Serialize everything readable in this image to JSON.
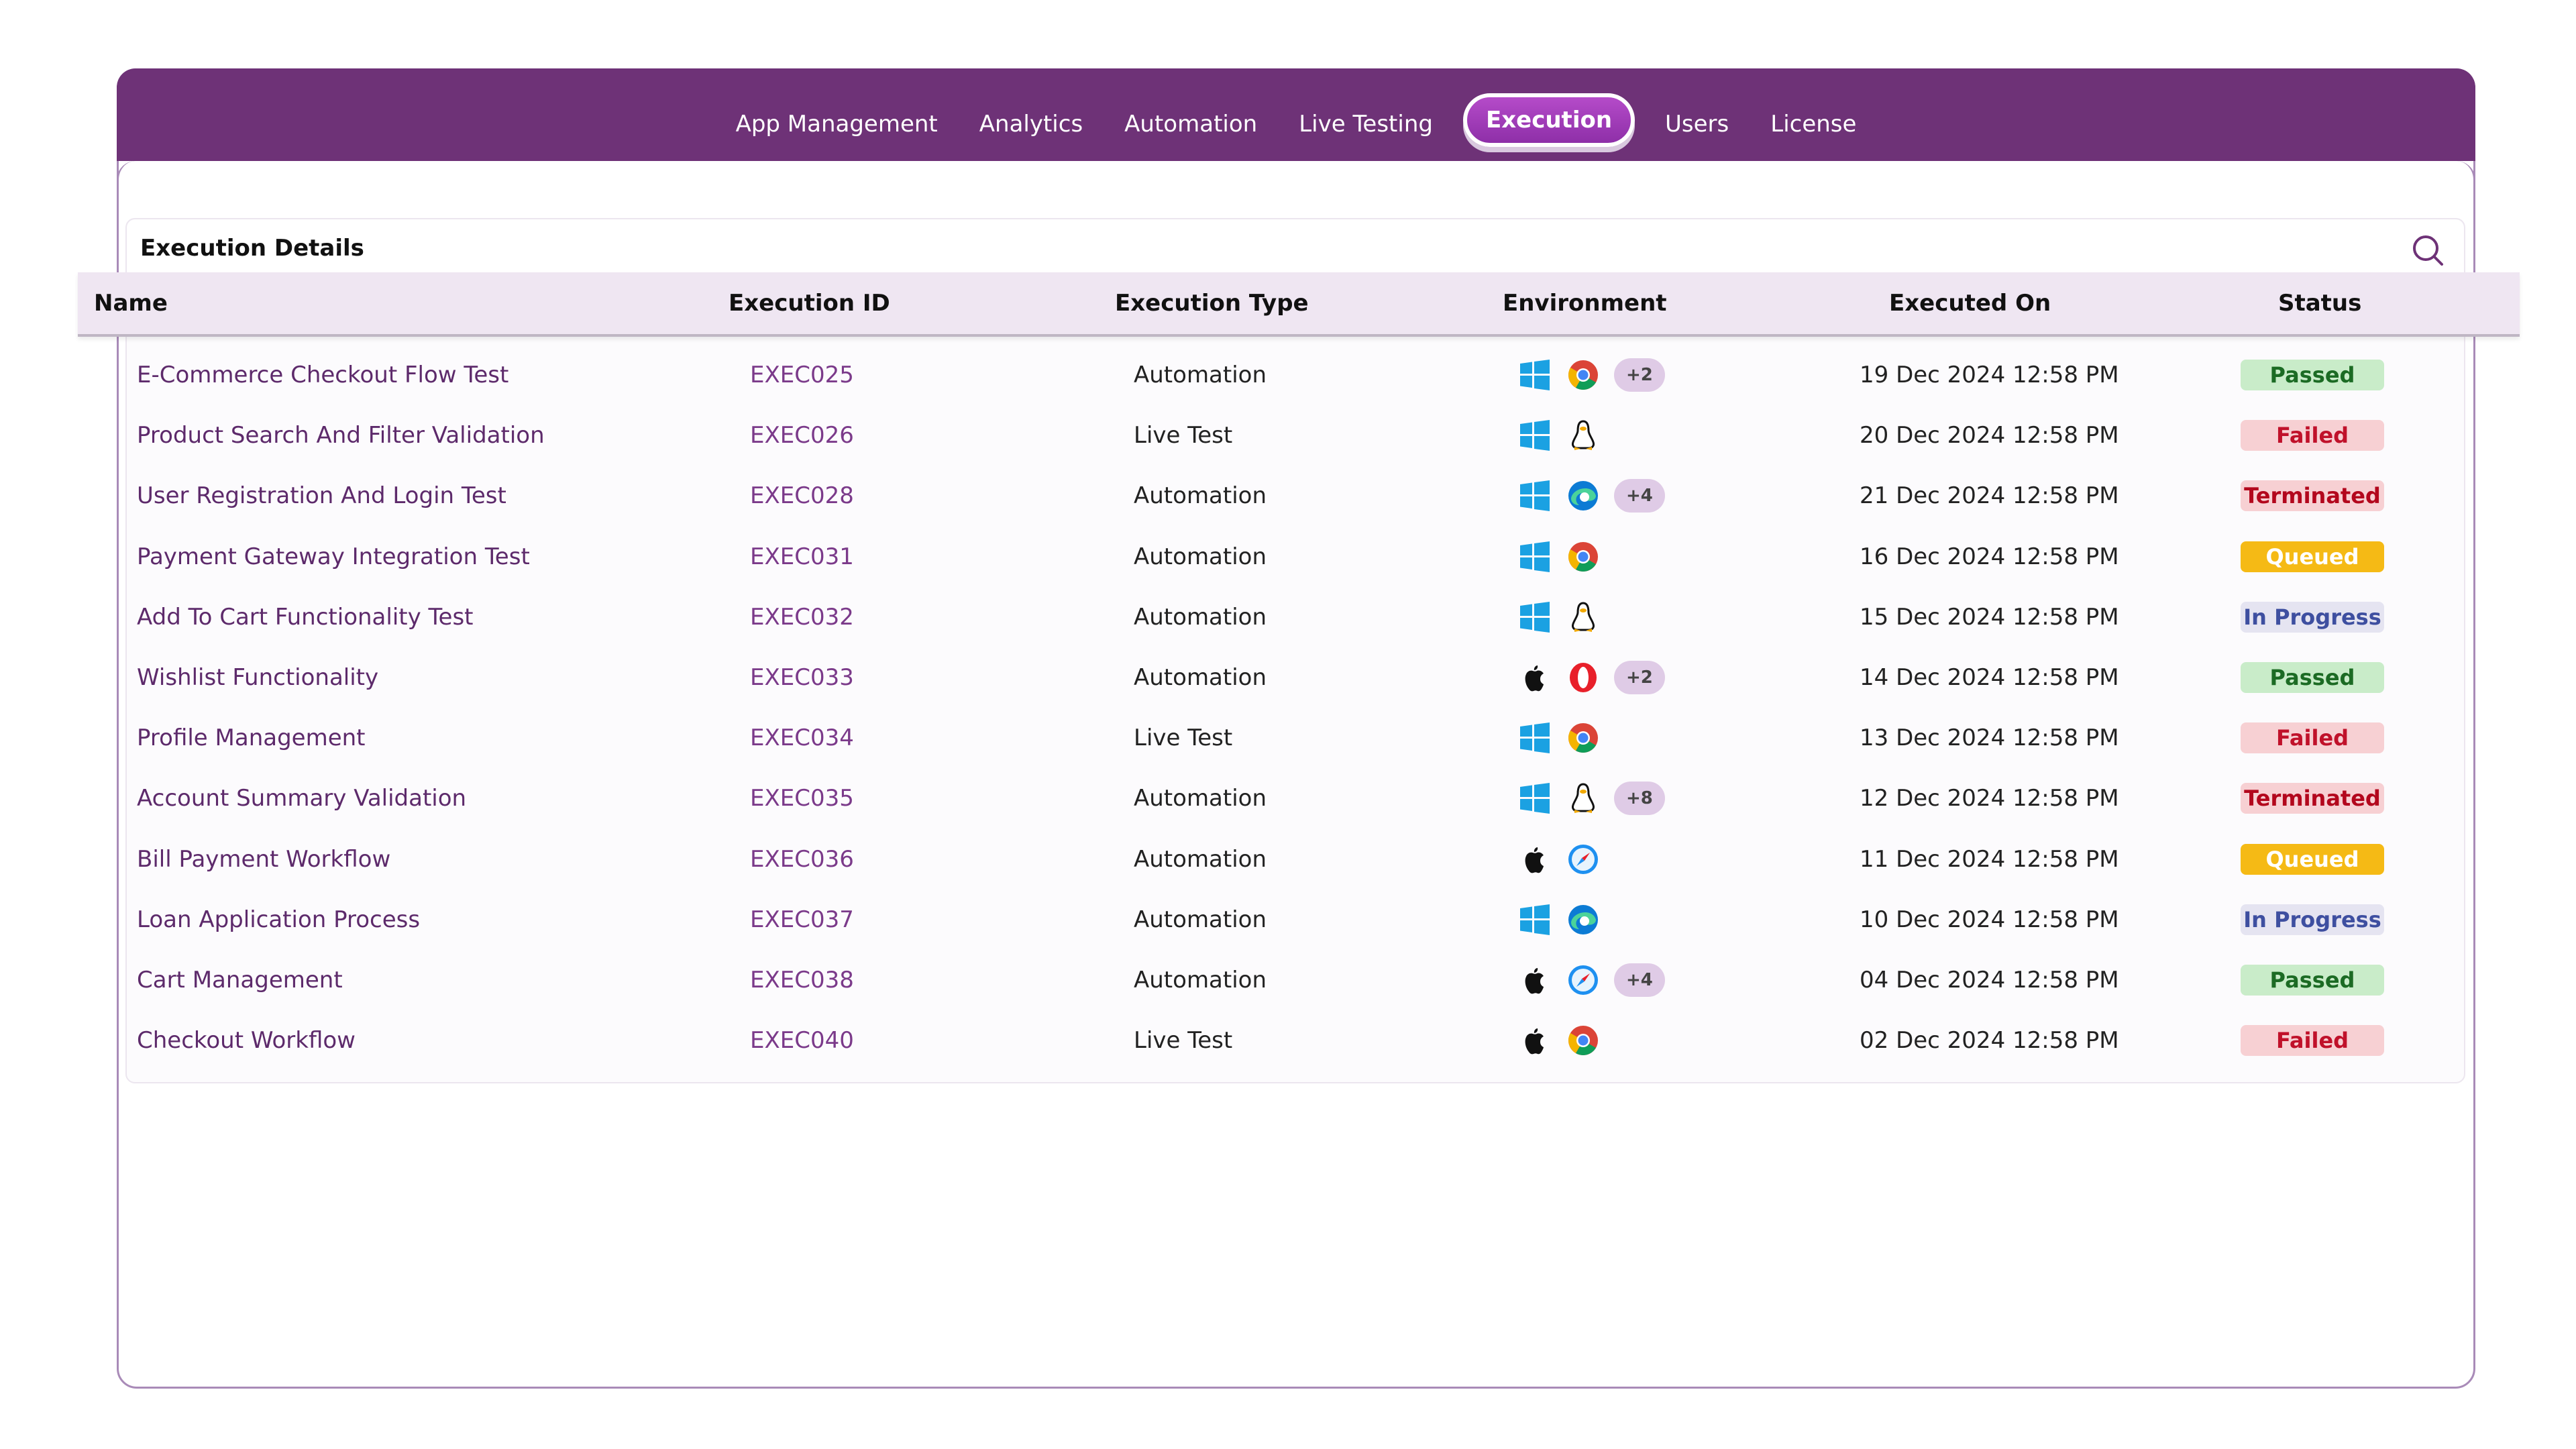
{
  "nav": {
    "items": [
      {
        "label": "App Management",
        "icon": ""
      },
      {
        "label": "Analytics"
      },
      {
        "label": "Automation"
      },
      {
        "label": "Live Testing"
      },
      {
        "label": "Execution",
        "active": true
      },
      {
        "label": "Users"
      },
      {
        "label": "License"
      }
    ]
  },
  "panel": {
    "title": "Execution Details",
    "search_icon": "search-icon"
  },
  "table": {
    "columns": [
      "Name",
      "Execution ID",
      "Execution Type",
      "Environment",
      "Executed On",
      "Status"
    ],
    "rows": [
      {
        "name": "E-Commerce Checkout Flow Test",
        "id": "EXEC025",
        "type": "Automation",
        "env": [
          "windows",
          "chrome"
        ],
        "more": "+2",
        "date": "19 Dec 2024 12:58 PM",
        "status": "Passed"
      },
      {
        "name": "Product Search And Filter Validation",
        "id": "EXEC026",
        "type": "Live Test",
        "env": [
          "windows",
          "linux"
        ],
        "more": "",
        "date": "20 Dec 2024 12:58 PM",
        "status": "Failed"
      },
      {
        "name": "User Registration And Login Test",
        "id": "EXEC028",
        "type": "Automation",
        "env": [
          "windows",
          "edge"
        ],
        "more": "+4",
        "date": "21 Dec 2024 12:58 PM",
        "status": "Terminated"
      },
      {
        "name": "Payment Gateway Integration Test",
        "id": "EXEC031",
        "type": "Automation",
        "env": [
          "windows",
          "chrome"
        ],
        "more": "",
        "date": "16 Dec 2024 12:58 PM",
        "status": "Queued"
      },
      {
        "name": "Add To Cart Functionality Test",
        "id": "EXEC032",
        "type": "Automation",
        "env": [
          "windows",
          "linux"
        ],
        "more": "",
        "date": "15 Dec 2024 12:58 PM",
        "status": "In Progress"
      },
      {
        "name": "Wishlist Functionality",
        "id": "EXEC033",
        "type": "Automation",
        "env": [
          "apple",
          "opera"
        ],
        "more": "+2",
        "date": "14 Dec 2024 12:58 PM",
        "status": "Passed"
      },
      {
        "name": "Profile Management",
        "id": "EXEC034",
        "type": "Live Test",
        "env": [
          "windows",
          "chrome"
        ],
        "more": "",
        "date": "13 Dec 2024 12:58 PM",
        "status": "Failed"
      },
      {
        "name": "Account Summary Validation",
        "id": "EXEC035",
        "type": "Automation",
        "env": [
          "windows",
          "linux"
        ],
        "more": "+8",
        "date": "12 Dec 2024 12:58 PM",
        "status": "Terminated"
      },
      {
        "name": "Bill Payment Workflow",
        "id": "EXEC036",
        "type": "Automation",
        "env": [
          "apple",
          "safari"
        ],
        "more": "",
        "date": "11 Dec 2024 12:58 PM",
        "status": "Queued"
      },
      {
        "name": "Loan Application Process",
        "id": "EXEC037",
        "type": "Automation",
        "env": [
          "windows",
          "edge"
        ],
        "more": "",
        "date": "10 Dec 2024 12:58 PM",
        "status": "In Progress"
      },
      {
        "name": "Cart Management",
        "id": "EXEC038",
        "type": "Automation",
        "env": [
          "apple",
          "safari"
        ],
        "more": "+4",
        "date": "04 Dec 2024 12:58 PM",
        "status": "Passed"
      },
      {
        "name": "Checkout Workflow",
        "id": "EXEC040",
        "type": "Live Test",
        "env": [
          "apple",
          "chrome"
        ],
        "more": "",
        "date": "02 Dec 2024 12:58 PM",
        "status": "Failed"
      }
    ]
  },
  "colors": {
    "brand": "#6e3277",
    "accent": "#a13dbd",
    "passed": "#1c6b24",
    "failed": "#c0112a",
    "queued": "#f5ba15",
    "inprogress": "#3e4fa0"
  }
}
